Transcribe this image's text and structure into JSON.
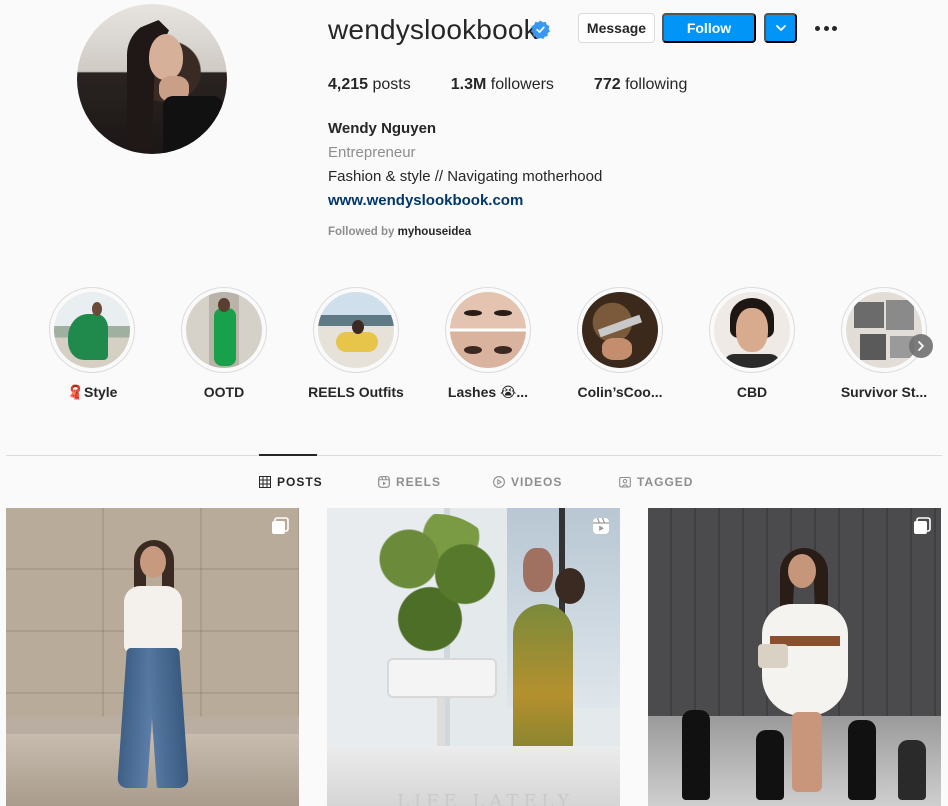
{
  "profile": {
    "username": "wendyslookbook",
    "verified": true,
    "buttons": {
      "message": "Message",
      "follow": "Follow"
    },
    "stats": [
      {
        "value": "4,215",
        "label": "posts"
      },
      {
        "value": "1.3M",
        "label": "followers"
      },
      {
        "value": "772",
        "label": "following"
      }
    ],
    "full_name": "Wendy Nguyen",
    "category": "Entrepreneur",
    "bio": "Fashion & style // Navigating motherhood",
    "website": "www.wendyslookbook.com",
    "followed_by_prefix": "Followed by",
    "followed_by_user": "myhouseidea"
  },
  "highlights": [
    {
      "label": "🧣Style"
    },
    {
      "label": "OOTD"
    },
    {
      "label": "REELS Outfits"
    },
    {
      "label": "Lashes 😭..."
    },
    {
      "label": "Colin’sCoo..."
    },
    {
      "label": "CBD"
    },
    {
      "label": "Survivor St..."
    }
  ],
  "tabs": [
    {
      "label": "POSTS",
      "active": true,
      "icon": "grid-icon"
    },
    {
      "label": "REELS",
      "active": false,
      "icon": "reels-icon"
    },
    {
      "label": "VIDEOS",
      "active": false,
      "icon": "play-icon"
    },
    {
      "label": "TAGGED",
      "active": false,
      "icon": "tag-icon"
    }
  ],
  "posts": [
    {
      "badge": "carousel-icon"
    },
    {
      "badge": "reels-icon",
      "caption": "LIFE LATELY"
    },
    {
      "badge": "carousel-icon"
    }
  ],
  "colors": {
    "accent": "#0095f6",
    "link": "#00376b",
    "muted": "#8e8e8e",
    "text": "#262626",
    "background": "#fafafa"
  }
}
